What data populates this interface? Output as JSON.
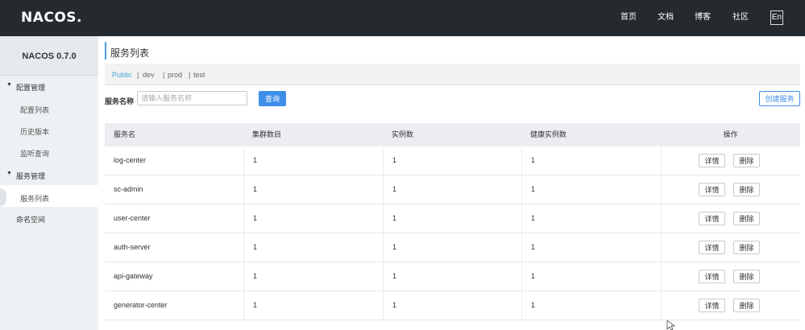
{
  "header": {
    "logo_text": "NACOS.",
    "nav": [
      "首页",
      "文档",
      "博客",
      "社区"
    ],
    "lang": "En"
  },
  "sidebar": {
    "title": "NACOS 0.7.0",
    "groups": [
      {
        "label": "配置管理",
        "items": [
          "配置列表",
          "历史版本",
          "监听查询"
        ]
      },
      {
        "label": "服务管理",
        "items": [
          "服务列表"
        ]
      }
    ],
    "namespace_label": "命名空间",
    "active_item": "服务列表"
  },
  "main": {
    "title": "服务列表",
    "namespaces": [
      "Public",
      "dev",
      "prod",
      "test"
    ],
    "active_namespace": "Public",
    "search": {
      "label": "服务名称",
      "placeholder": "请输入服务名称",
      "query_label": "查询"
    },
    "create_label": "创建服务",
    "table": {
      "columns": [
        "服务名",
        "集群数目",
        "实例数",
        "健康实例数",
        "操作"
      ],
      "rows": [
        {
          "name": "log-center",
          "clusters": "1",
          "instances": "1",
          "healthy": "1"
        },
        {
          "name": "sc-admin",
          "clusters": "1",
          "instances": "1",
          "healthy": "1"
        },
        {
          "name": "user-center",
          "clusters": "1",
          "instances": "1",
          "healthy": "1"
        },
        {
          "name": "auth-server",
          "clusters": "1",
          "instances": "1",
          "healthy": "1"
        },
        {
          "name": "api-gateway",
          "clusters": "1",
          "instances": "1",
          "healthy": "1"
        },
        {
          "name": "generator-center",
          "clusters": "1",
          "instances": "1",
          "healthy": "1"
        }
      ],
      "detail_label": "详情",
      "delete_label": "删除"
    }
  },
  "colors": {
    "topbar": "#252a2f",
    "sidebar": "#eef1f3",
    "accent": "#3e8ee8",
    "namespace_active": "#40a6dc"
  }
}
